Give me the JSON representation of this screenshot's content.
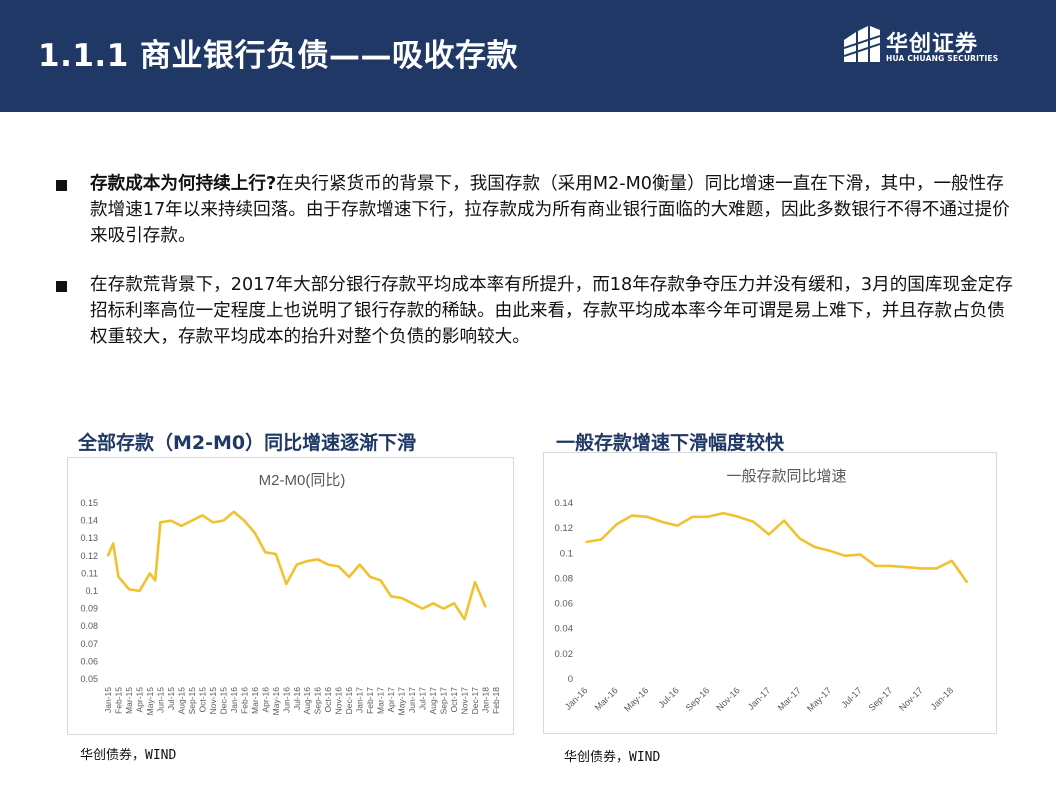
{
  "header": {
    "title": "1.1.1 商业银行负债——吸收存款",
    "logo_cn": "华创证券",
    "logo_en": "HUA CHUANG SECURITIES"
  },
  "bullets": [
    {
      "lead": "存款成本为何持续上行?",
      "text": "在央行紧货币的背景下，我国存款（采用M2-M0衡量）同比增速一直在下滑，其中，一般性存款增速17年以来持续回落。由于存款增速下行，拉存款成为所有商业银行面临的大难题，因此多数银行不得不通过提价来吸引存款。"
    },
    {
      "lead": "",
      "text": "在存款荒背景下，2017年大部分银行存款平均成本率有所提升，而18年存款争夺压力并没有缓和，3月的国库现金定存招标利率高位一定程度上也说明了银行存款的稀缺。由此来看，存款平均成本率今年可谓是易上难下，并且存款占负债权重较大，存款平均成本的抬升对整个负债的影响较大。"
    }
  ],
  "charts": {
    "left": {
      "heading": "全部存款（M2-M0）同比增速逐渐下滑",
      "source": "华创债券，WIND"
    },
    "right": {
      "heading": "一般存款增速下滑幅度较快",
      "source": "华创债券，WIND"
    }
  },
  "chart_data": [
    {
      "type": "line",
      "title": "M2-M0(同比)",
      "color": "#f2c12e",
      "ylim": [
        0.05,
        0.15
      ],
      "yticks": [
        "0.05",
        "0.06",
        "0.07",
        "0.08",
        "0.09",
        "0.1",
        "0.11",
        "0.12",
        "0.13",
        "0.14",
        "0.15"
      ],
      "categories": [
        "Jan-15",
        "Feb-15",
        "Mar-15",
        "Apr-15",
        "May-15",
        "Jun-15",
        "Jul-15",
        "Aug-15",
        "Sep-15",
        "Oct-15",
        "Nov-15",
        "Dec-15",
        "Jan-16",
        "Feb-16",
        "Mar-16",
        "Apr-16",
        "May-16",
        "Jun-16",
        "Jul-16",
        "Aug-16",
        "Sep-16",
        "Oct-16",
        "Nov-16",
        "Dec-16",
        "Jan-17",
        "Feb-17",
        "Mar-17",
        "Apr-17",
        "May-17",
        "Jun-17",
        "Jul-17",
        "Aug-17",
        "Sep-17",
        "Oct-17",
        "Nov-17",
        "Dec-17",
        "Jan-18",
        "Feb-18"
      ],
      "x": [
        0,
        0.5,
        1,
        2,
        3,
        4,
        4.5,
        5,
        6,
        7,
        8,
        9,
        10,
        11,
        12,
        13,
        14,
        15,
        16,
        17,
        18,
        19,
        20,
        21,
        22,
        23,
        24,
        25,
        26,
        27,
        28,
        29,
        30,
        31,
        32,
        33,
        34,
        35,
        36,
        37
      ],
      "values": [
        0.12,
        0.127,
        0.108,
        0.101,
        0.1,
        0.11,
        0.106,
        0.139,
        0.14,
        0.137,
        0.14,
        0.143,
        0.139,
        0.14,
        0.145,
        0.14,
        0.133,
        0.122,
        0.121,
        0.104,
        0.115,
        0.117,
        0.118,
        0.115,
        0.114,
        0.108,
        0.115,
        0.108,
        0.106,
        0.097,
        0.096,
        0.093,
        0.09,
        0.093,
        0.09,
        0.093,
        0.084,
        0.105,
        0.091
      ]
    },
    {
      "type": "line",
      "title": "一般存款同比增速",
      "color": "#f2c12e",
      "ylim": [
        0,
        0.14
      ],
      "yticks": [
        "0",
        "0.02",
        "0.04",
        "0.06",
        "0.08",
        "0.1",
        "0.12",
        "0.14"
      ],
      "x": [
        "Jan-16",
        "Feb-16",
        "Mar-16",
        "Apr-16",
        "May-16",
        "Jun-16",
        "Jul-16",
        "Aug-16",
        "Sep-16",
        "Oct-16",
        "Nov-16",
        "Dec-16",
        "Jan-17",
        "Feb-17",
        "Mar-17",
        "Apr-17",
        "May-17",
        "Jun-17",
        "Jul-17",
        "Aug-17",
        "Sep-17",
        "Oct-17",
        "Nov-17",
        "Dec-17",
        "Jan-18",
        "Feb-18"
      ],
      "tick_labels": [
        "Jan-16",
        "Mar-16",
        "May-16",
        "Jul-16",
        "Sep-16",
        "Nov-16",
        "Jan-17",
        "Mar-17",
        "May-17",
        "Jul-17",
        "Sep-17",
        "Nov-17",
        "Jan-18"
      ],
      "values": [
        0.109,
        0.111,
        0.123,
        0.13,
        0.129,
        0.125,
        0.122,
        0.129,
        0.129,
        0.132,
        0.129,
        0.125,
        0.115,
        0.126,
        0.112,
        0.105,
        0.102,
        0.098,
        0.099,
        0.09,
        0.09,
        0.089,
        0.088,
        0.088,
        0.094,
        0.077
      ]
    }
  ]
}
